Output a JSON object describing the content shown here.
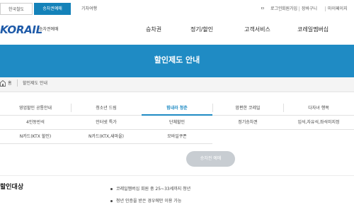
{
  "top_tabs": [
    "한국철도",
    "승차권예매",
    "기차여행"
  ],
  "utility": [
    "로그인",
    "회원가입",
    "장바구니",
    "마이페이지"
  ],
  "utility_lead": "ㅁ",
  "logo": {
    "mark": "KORAIL",
    "sub": "승차권예매"
  },
  "gnb": [
    "승차권",
    "정기/할인",
    "고객서비스",
    "코레일멤버십"
  ],
  "banner_title": "할인제도 안내",
  "breadcrumb": {
    "home": "홈",
    "current": "할인제도 안내"
  },
  "tabs": [
    [
      "영업할인 공통안내",
      "청소년 드림",
      "힘내라 청춘",
      "맘편한 코레일",
      "다자녀 행복"
    ],
    [
      "4인동반석",
      "인터넷 특가",
      "단체할인",
      "정기승차권",
      "입석,자유석,좌석미지정"
    ],
    [
      "N카드(KTX 할인)",
      "N카드(KTX,새마을)",
      "모바일쿠폰"
    ]
  ],
  "active_tab": "힘내라 청춘",
  "button_label": "승차권 예매",
  "section_title": "할인대상",
  "bullets": [
    "코레일멤버십 회원 중 25~33세까지 청년",
    "청년 인증을 받은 경우에만 이용 가능"
  ],
  "colors": {
    "accent": "#1f8bc4",
    "button_disabled": "#c8cdd2",
    "top_active": "#1482b9"
  }
}
